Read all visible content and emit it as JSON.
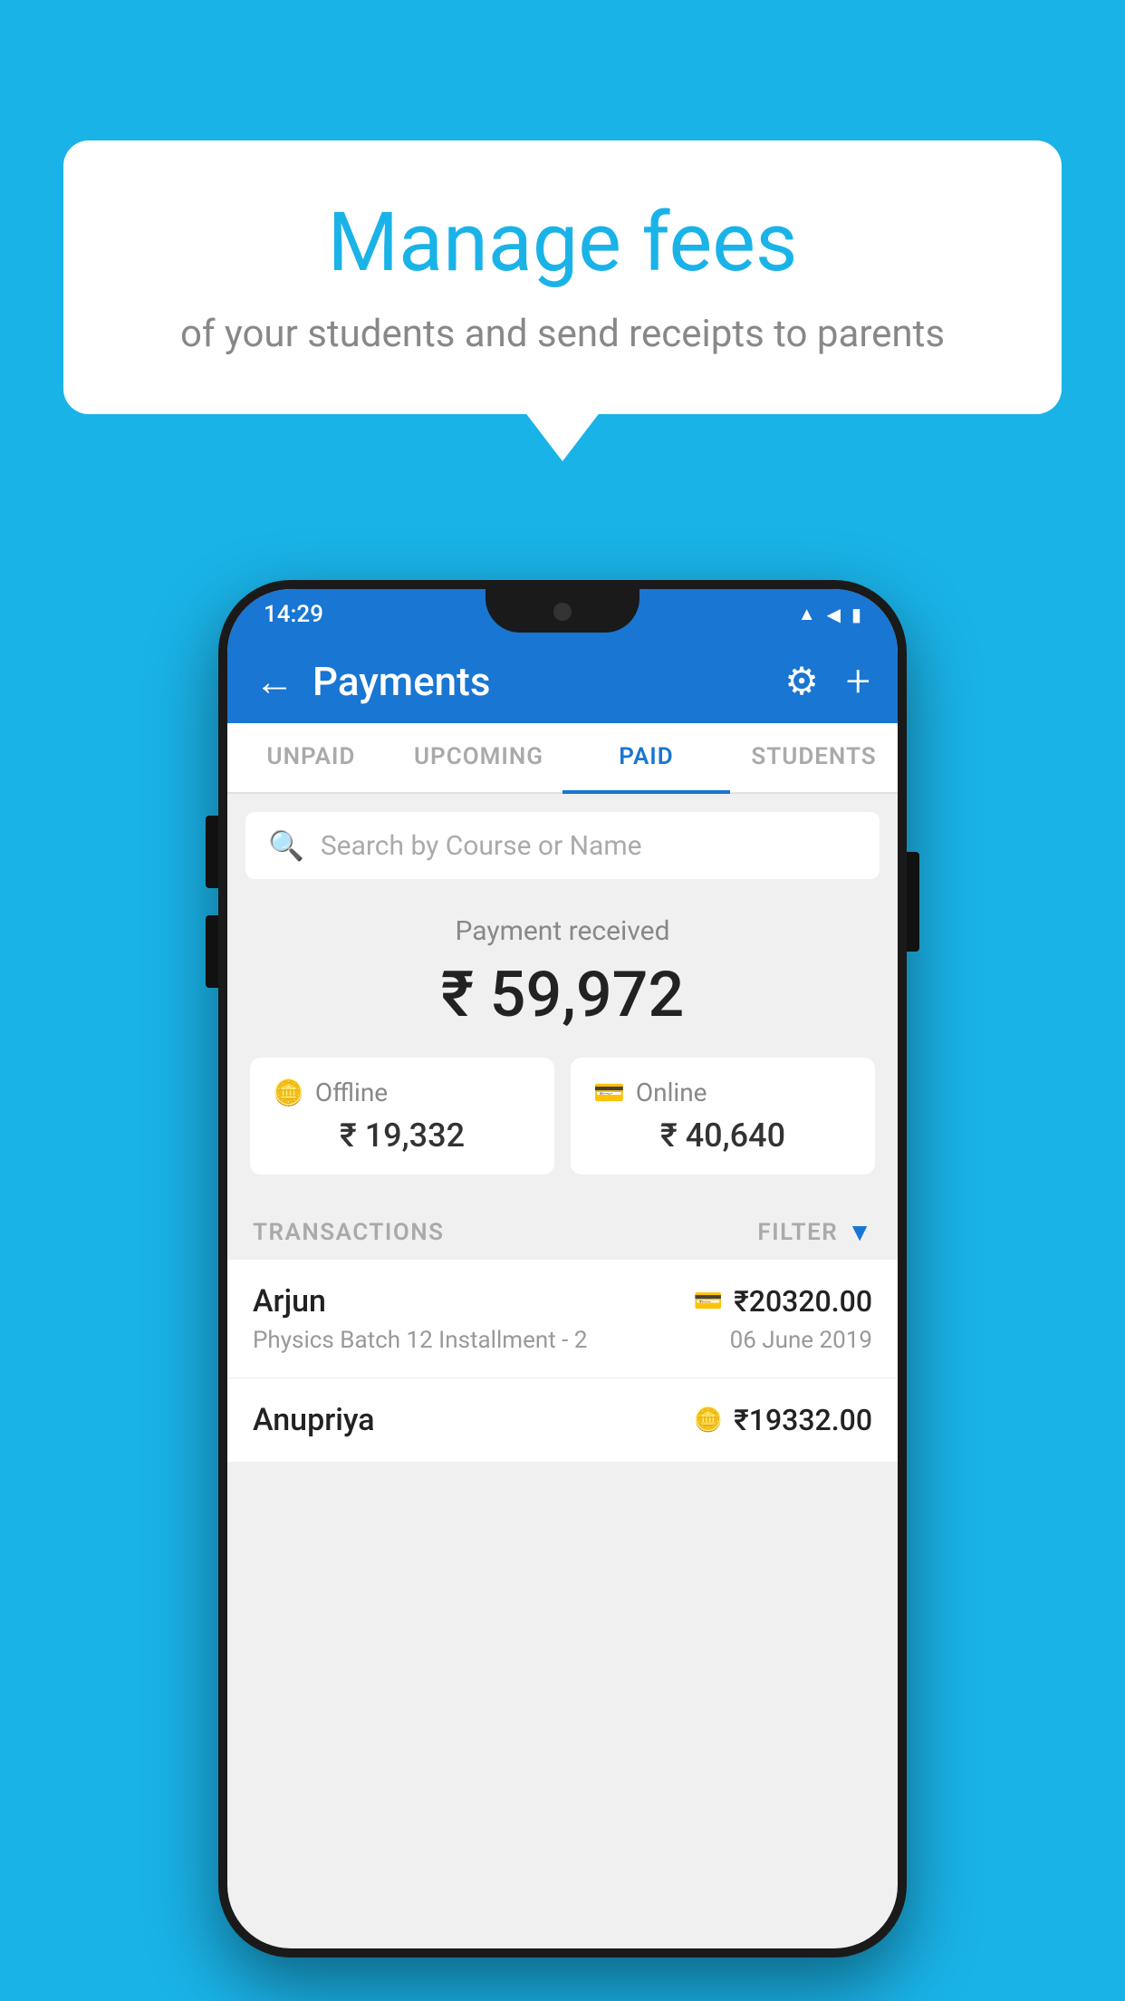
{
  "page": {
    "background_color": "#1ab3e8"
  },
  "speech_bubble": {
    "title": "Manage fees",
    "subtitle": "of your students and send receipts to parents"
  },
  "phone": {
    "status_bar": {
      "time": "14:29",
      "wifi": "▲",
      "signal": "◀",
      "battery": "▮"
    },
    "header": {
      "back_label": "←",
      "title": "Payments",
      "settings_icon": "⚙",
      "add_icon": "+"
    },
    "tabs": [
      {
        "label": "UNPAID",
        "active": false
      },
      {
        "label": "UPCOMING",
        "active": false
      },
      {
        "label": "PAID",
        "active": true
      },
      {
        "label": "STUDENTS",
        "active": false
      }
    ],
    "search": {
      "placeholder": "Search by Course or Name"
    },
    "payment_received": {
      "label": "Payment received",
      "amount": "₹ 59,972",
      "offline": {
        "icon": "💳",
        "label": "Offline",
        "amount": "₹ 19,332"
      },
      "online": {
        "icon": "💳",
        "label": "Online",
        "amount": "₹ 40,640"
      }
    },
    "transactions": {
      "header_label": "TRANSACTIONS",
      "filter_label": "FILTER",
      "rows": [
        {
          "name": "Arjun",
          "type_icon": "💳",
          "amount": "₹20320.00",
          "description": "Physics Batch 12 Installment - 2",
          "date": "06 June 2019"
        },
        {
          "name": "Anupriya",
          "type_icon": "💳",
          "amount": "₹19332.00",
          "description": "",
          "date": ""
        }
      ]
    }
  }
}
